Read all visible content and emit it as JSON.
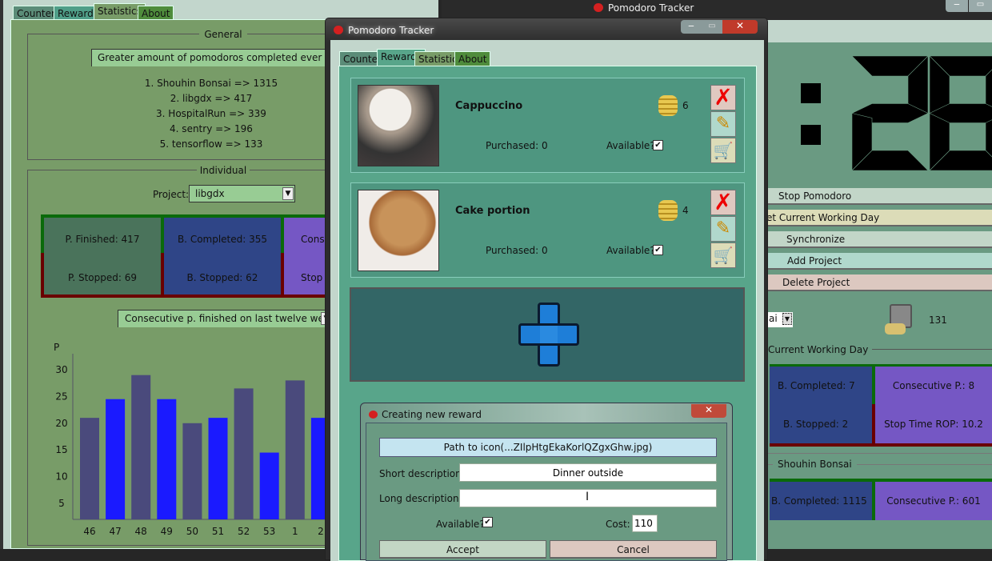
{
  "left_window": {
    "tabs": [
      "Counter",
      "Rewards",
      "Statistics",
      "About"
    ],
    "active_tab": "Statistics",
    "general": {
      "title": "General",
      "selector": "Greater amount of pomodoros completed ever",
      "ranking": [
        "1. Shouhin Bonsai => 1315",
        "2. libgdx => 417",
        "3. HospitalRun => 339",
        "4. sentry => 196",
        "5. tensorflow => 133"
      ]
    },
    "individual": {
      "title": "Individual",
      "project_label": "Project:",
      "project_value": "libgdx",
      "stats": {
        "p_finished": "P. Finished: 417",
        "p_stopped": "P. Stopped: 69",
        "b_completed": "B. Completed: 355",
        "b_stopped": "B. Stopped: 62",
        "consecutive": "Conse",
        "stop_time": "Stop T"
      },
      "chart_selector": "Consecutive p. finished on last twelve weeks"
    }
  },
  "chart_data": {
    "type": "bar",
    "ylabel": "P",
    "categories": [
      "46",
      "47",
      "48",
      "49",
      "50",
      "51",
      "52",
      "53",
      "1",
      "2"
    ],
    "values": [
      21,
      24.5,
      29,
      24.5,
      20,
      21,
      26.5,
      14.5,
      28,
      21
    ],
    "yticks": [
      "30",
      "25",
      "20",
      "15",
      "10",
      "5"
    ],
    "colors": [
      "#4a4a7c",
      "#1a1aff"
    ],
    "grid": false
  },
  "right_window": {
    "title": "Pomodoro Tracker",
    "clock": "28",
    "clock_separator": ":",
    "buttons": {
      "stop": "Stop Pomodoro",
      "reset": "et Current Working Day",
      "sync": "Synchronize",
      "add": "Add Project",
      "delete": "Delete Project"
    },
    "project_combo": "ai",
    "coins": "131",
    "current_day_title": "Current Working Day",
    "current_day": {
      "b_completed": "B. Completed: 7",
      "b_stopped": "B. Stopped: 2",
      "consecutive": "Consecutive P.: 8",
      "stop_time": "Stop Time ROP: 10.2"
    },
    "project_title": "Shouhin Bonsai",
    "project": {
      "b_completed": "B. Completed: 1115",
      "consecutive": "Consecutive P.: 601"
    }
  },
  "main_window": {
    "title": "Pomodoro Tracker",
    "tabs": [
      "Counter",
      "Rewards",
      "Statistics",
      "About"
    ],
    "active_tab": "Rewards",
    "rewards": [
      {
        "name": "Cappuccino",
        "cost": "6",
        "purchased": "Purchased: 0",
        "available_label": "Available?",
        "available": true
      },
      {
        "name": "Cake portion",
        "cost": "4",
        "purchased": "Purchased: 0",
        "available_label": "Available?",
        "available": true
      }
    ]
  },
  "dialog": {
    "title": "Creating new reward",
    "path_button": "Path to icon(...ZIlpHtgEkaKorlQZgxGhw.jpg)",
    "short_label": "Short description:",
    "short_value": "Dinner outside",
    "long_label": "Long description:",
    "long_value": "",
    "available_label": "Available?",
    "available": true,
    "cost_label": "Cost:",
    "cost_value": "110",
    "accept": "Accept",
    "cancel": "Cancel"
  },
  "colors": {
    "panel_green": "#789c68",
    "rewards_panel": "#58a58a",
    "dialog_body": "#6a9a82",
    "box_blue": "#2f4587",
    "box_purple": "#7557c4",
    "box_dark": "#4a735b",
    "border_green": "#0a6a0a",
    "border_red": "#6a0000"
  }
}
